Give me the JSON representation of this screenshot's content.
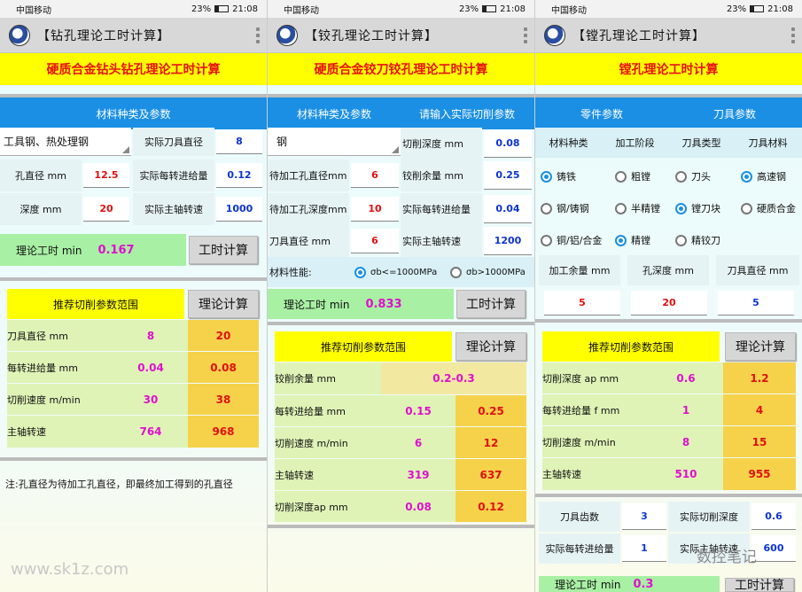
{
  "status": {
    "carrier": "中国移动",
    "battery": "23%",
    "time": "21:08"
  },
  "s1": {
    "title": "【钻孔理论工时计算】",
    "banner": "硬质合金钻头钻孔理论工时计算",
    "header": "材料种类及参数",
    "material": "工具钢、热处理钢",
    "rows": [
      {
        "l": "实际刀具直径",
        "v": "8"
      },
      {
        "l": "孔直径 mm",
        "v": "12.5"
      },
      {
        "l": "实际每转进给量",
        "v": "0.12"
      },
      {
        "l": "深度 mm",
        "v": "20"
      },
      {
        "l": "实际主轴转速",
        "v": "1000"
      }
    ],
    "result_label": "理论工时 min",
    "result": "0.167",
    "calc_btn": "工时计算",
    "rec_title": "推荐切削参数范围",
    "theory_btn": "理论计算",
    "rec": [
      {
        "l": "刀具直径 mm",
        "a": "8",
        "b": "20"
      },
      {
        "l": "每转进给量 mm",
        "a": "0.04",
        "b": "0.08"
      },
      {
        "l": "切削速度 m/min",
        "a": "30",
        "b": "38"
      },
      {
        "l": "主轴转速",
        "a": "764",
        "b": "968"
      }
    ],
    "note": "注:孔直径为待加工孔直径，即最终加工得到的孔直径"
  },
  "s2": {
    "title": "【铰孔理论工时计算】",
    "banner": "硬质合金铰刀铰孔理论工时计算",
    "header_l": "材料种类及参数",
    "header_r": "请输入实际切削参数",
    "material": "钢",
    "left": [
      {
        "l": "待加工孔直径mm",
        "v": "6"
      },
      {
        "l": "待加工孔深度mm",
        "v": "10"
      },
      {
        "l": "刀具直径 mm",
        "v": "6"
      }
    ],
    "right": [
      {
        "l": "切削深度 mm",
        "v": "0.08"
      },
      {
        "l": "铰削余量 mm",
        "v": "0.25"
      },
      {
        "l": "实际每转进给量",
        "v": "0.04"
      },
      {
        "l": "实际主轴转速",
        "v": "1200"
      }
    ],
    "perf_label": "材料性能:",
    "perf_a": "σb<=1000MPa",
    "perf_b": "σb>1000MPa",
    "result_label": "理论工时 min",
    "result": "0.833",
    "calc_btn": "工时计算",
    "rec_title": "推荐切削参数范围",
    "theory_btn": "理论计算",
    "rec_first": {
      "l": "铰削余量  mm",
      "v": "0.2-0.3"
    },
    "rec": [
      {
        "l": "每转进给量 mm",
        "a": "0.15",
        "b": "0.25"
      },
      {
        "l": "切削速度 m/min",
        "a": "6",
        "b": "12"
      },
      {
        "l": "主轴转速",
        "a": "319",
        "b": "637"
      },
      {
        "l": "切削深度ap mm",
        "a": "0.08",
        "b": "0.12"
      }
    ]
  },
  "s3": {
    "title": "【镗孔理论工时计算】",
    "banner": "镗孔理论工时计算",
    "header_l": "零件参数",
    "header_r": "刀具参数",
    "cols": [
      "材料种类",
      "加工阶段",
      "刀具类型",
      "刀具材料"
    ],
    "radios": [
      [
        "铸铁",
        "粗镗",
        "刀头",
        "高速钢"
      ],
      [
        "钢/铸钢",
        "半精镗",
        "镗刀块",
        "硬质合金"
      ],
      [
        "铜/铝/合金",
        "精镗",
        "精铰刀",
        ""
      ]
    ],
    "params": [
      {
        "l": "加工余量 mm",
        "v": "5"
      },
      {
        "l": "孔深度 mm",
        "v": "20"
      },
      {
        "l": "刀具直径 mm",
        "v": "5"
      }
    ],
    "rec_title": "推荐切削参数范围",
    "theory_btn": "理论计算",
    "rec": [
      {
        "l": "切削深度 ap mm",
        "a": "0.6",
        "b": "1.2"
      },
      {
        "l": "每转进给量 f mm",
        "a": "1",
        "b": "4"
      },
      {
        "l": "切削速度 m/min",
        "a": "8",
        "b": "15"
      },
      {
        "l": "主轴转速",
        "a": "510",
        "b": "955"
      }
    ],
    "teeth_l": "刀具齿数",
    "teeth": "3",
    "depth_l": "实际切削深度",
    "depth": "0.6",
    "feed_l": "实际每转进给量",
    "feed": "1",
    "speed_l": "实际主轴转速",
    "speed": "600",
    "result_label": "理论工时 min",
    "result": "0.3",
    "calc_btn": "工时计算"
  },
  "watermark_l": "www.sk1z.com",
  "watermark_r": "数控笔记"
}
